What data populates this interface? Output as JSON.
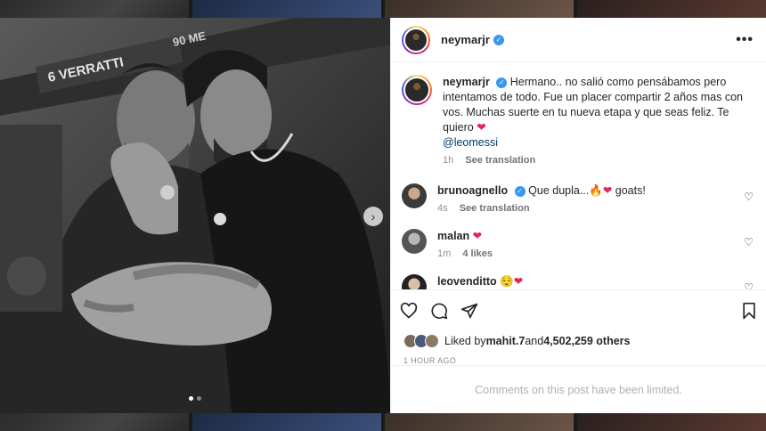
{
  "post": {
    "username": "neymarjr",
    "caption_username": "neymarjr",
    "caption": "Hermano.. no salió como pensábamos pero intentamos de todo. Fue un placer compartir 2 años mas con vos. Muchas suerte en tu nueva etapa y que seas feliz. Te quiero",
    "caption_emoji": "❤",
    "mention": "@leomessi",
    "age": "1h",
    "see_translation": "See translation",
    "jersey_text": "6 VERRATTI",
    "sign_text": "90 ME"
  },
  "comments": [
    {
      "username": "brunoagnello",
      "verified": true,
      "text": "Que dupla...",
      "emoji": "🔥❤",
      "text_after": " goats!",
      "age": "4s",
      "extra": "See translation"
    },
    {
      "username": "malan",
      "verified": false,
      "text": "",
      "emoji": "❤",
      "text_after": "",
      "age": "1m",
      "extra": "4 likes"
    },
    {
      "username": "leovenditto",
      "verified": false,
      "text": "",
      "emoji": "😌❤",
      "text_after": "",
      "age": "",
      "extra": ""
    }
  ],
  "likes": {
    "prefix": "Liked by ",
    "first_user": "mahit.7",
    "connector": " and ",
    "count": "4,502,259 others"
  },
  "timestamp": "1 HOUR AGO",
  "comments_limited": "Comments on this post have been limited.",
  "colors": {
    "verified": "#3897f0",
    "heart": "#ed4956",
    "mention": "#00376b"
  },
  "icons": [
    "more-icon",
    "verified-icon",
    "heart-icon",
    "comment-icon",
    "share-icon",
    "bookmark-icon",
    "chevron-right-icon"
  ]
}
